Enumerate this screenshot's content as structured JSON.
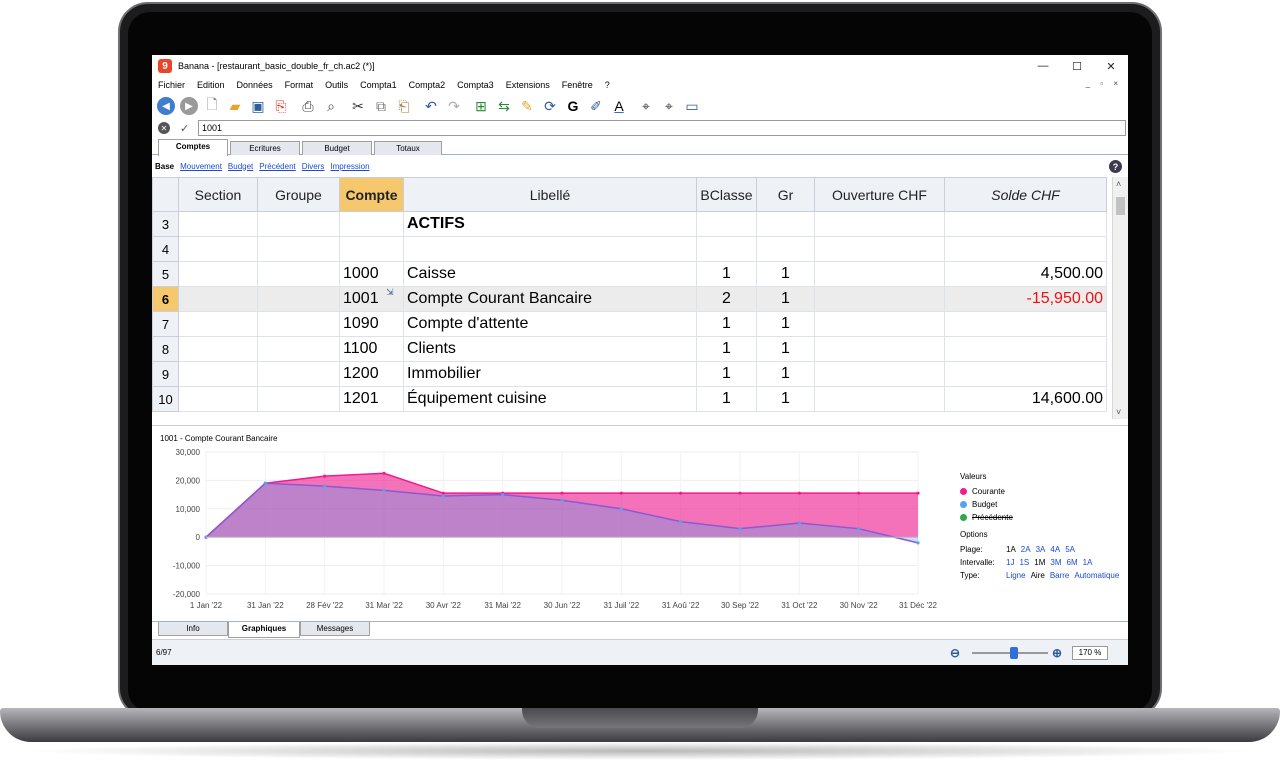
{
  "window": {
    "app_logo": "9",
    "title": "Banana - [restaurant_basic_double_fr_ch.ac2 (*)]",
    "minimize": "—",
    "maximize": "☐",
    "close": "✕"
  },
  "menu": [
    "Fichier",
    "Edition",
    "Données",
    "Format",
    "Outils",
    "Compta1",
    "Compta2",
    "Compta3",
    "Extensions",
    "Fenêtre",
    "?"
  ],
  "mdi_controls": "_ ▫ ×",
  "formula_bar": {
    "value": "1001",
    "cancel": "✕",
    "ok": "✓"
  },
  "table_tabs": [
    "Comptes",
    "Ecritures",
    "Budget",
    "Totaux"
  ],
  "views": {
    "current": "Base",
    "links": [
      "Mouvement",
      "Budget",
      "Précédent",
      "Divers",
      "Impression"
    ]
  },
  "help": "?",
  "grid": {
    "columns": [
      "Section",
      "Groupe",
      "Compte",
      "Libellé",
      "BClasse",
      "Gr",
      "Ouverture CHF",
      "Solde CHF"
    ],
    "rows": [
      {
        "num": "3",
        "section": "",
        "groupe": "",
        "compte": "",
        "libelle": "ACTIFS",
        "bclasse": "",
        "gr": "",
        "ouverture": "",
        "solde": ""
      },
      {
        "num": "4",
        "section": "",
        "groupe": "",
        "compte": "",
        "libelle": "",
        "bclasse": "",
        "gr": "",
        "ouverture": "",
        "solde": ""
      },
      {
        "num": "5",
        "section": "",
        "groupe": "",
        "compte": "1000",
        "libelle": "Caisse",
        "bclasse": "1",
        "gr": "1",
        "ouverture": "",
        "solde": "4,500.00"
      },
      {
        "num": "6",
        "section": "",
        "groupe": "",
        "compte": "1001",
        "libelle": "Compte Courant Bancaire",
        "bclasse": "2",
        "gr": "1",
        "ouverture": "",
        "solde": "-15,950.00"
      },
      {
        "num": "7",
        "section": "",
        "groupe": "",
        "compte": "1090",
        "libelle": "Compte d'attente",
        "bclasse": "1",
        "gr": "1",
        "ouverture": "",
        "solde": ""
      },
      {
        "num": "8",
        "section": "",
        "groupe": "",
        "compte": "1100",
        "libelle": "Clients",
        "bclasse": "1",
        "gr": "1",
        "ouverture": "",
        "solde": ""
      },
      {
        "num": "9",
        "section": "",
        "groupe": "",
        "compte": "1200",
        "libelle": "Immobilier",
        "bclasse": "1",
        "gr": "1",
        "ouverture": "",
        "solde": ""
      },
      {
        "num": "10",
        "section": "",
        "groupe": "",
        "compte": "1201",
        "libelle": "Équipement cuisine",
        "bclasse": "1",
        "gr": "1",
        "ouverture": "",
        "solde": "14,600.00"
      }
    ]
  },
  "chart_data": {
    "type": "area",
    "title": "1001 - Compte Courant Bancaire",
    "categories": [
      "1 Jan '22",
      "31 Jan '22",
      "28 Fév '22",
      "31 Mar '22",
      "30 Avr '22",
      "31 Mai '22",
      "30 Jun '22",
      "31 Juil '22",
      "31 Aoû '22",
      "30 Sep '22",
      "31 Oct '22",
      "30 Nov '22",
      "31 Déc '22"
    ],
    "y_ticks": [
      "30,000",
      "20,000",
      "10,000",
      "0",
      "-10,000",
      "-20,000"
    ],
    "ylim": [
      -20000,
      30000
    ],
    "series": [
      {
        "name": "Courante",
        "color": "#ee1c8e",
        "values": [
          0,
          19000,
          21500,
          22500,
          15500,
          15500,
          15500,
          15500,
          15500,
          15500,
          15500,
          15500,
          15500
        ]
      },
      {
        "name": "Budget",
        "color": "#5aa0ee",
        "values": [
          0,
          19000,
          18000,
          16500,
          14500,
          15000,
          13000,
          10000,
          5500,
          3000,
          5000,
          3000,
          -2000
        ]
      }
    ],
    "legend_placement": "right",
    "grid": true
  },
  "legend": {
    "heading": "Valeurs",
    "items": [
      {
        "label": "Courante",
        "color": "#ee1c8e",
        "struck": false
      },
      {
        "label": "Budget",
        "color": "#5aa0ee",
        "struck": false
      },
      {
        "label": "Précédente",
        "color": "#2ea84a",
        "struck": true
      }
    ],
    "options_heading": "Options",
    "plage_label": "Plage:",
    "plage_values": [
      "1A",
      "2A",
      "3A",
      "4A",
      "5A"
    ],
    "intervalle_label": "Intervalle:",
    "intervalle_values": [
      "1J",
      "1S",
      "1M",
      "3M",
      "6M",
      "1A"
    ],
    "type_label": "Type:",
    "type_values": [
      "Ligne",
      "Aire",
      "Barre",
      "Automatique"
    ]
  },
  "panel_tabs": [
    "Info",
    "Graphiques",
    "Messages"
  ],
  "status": {
    "position": "6/97",
    "zoom": "170 %"
  }
}
